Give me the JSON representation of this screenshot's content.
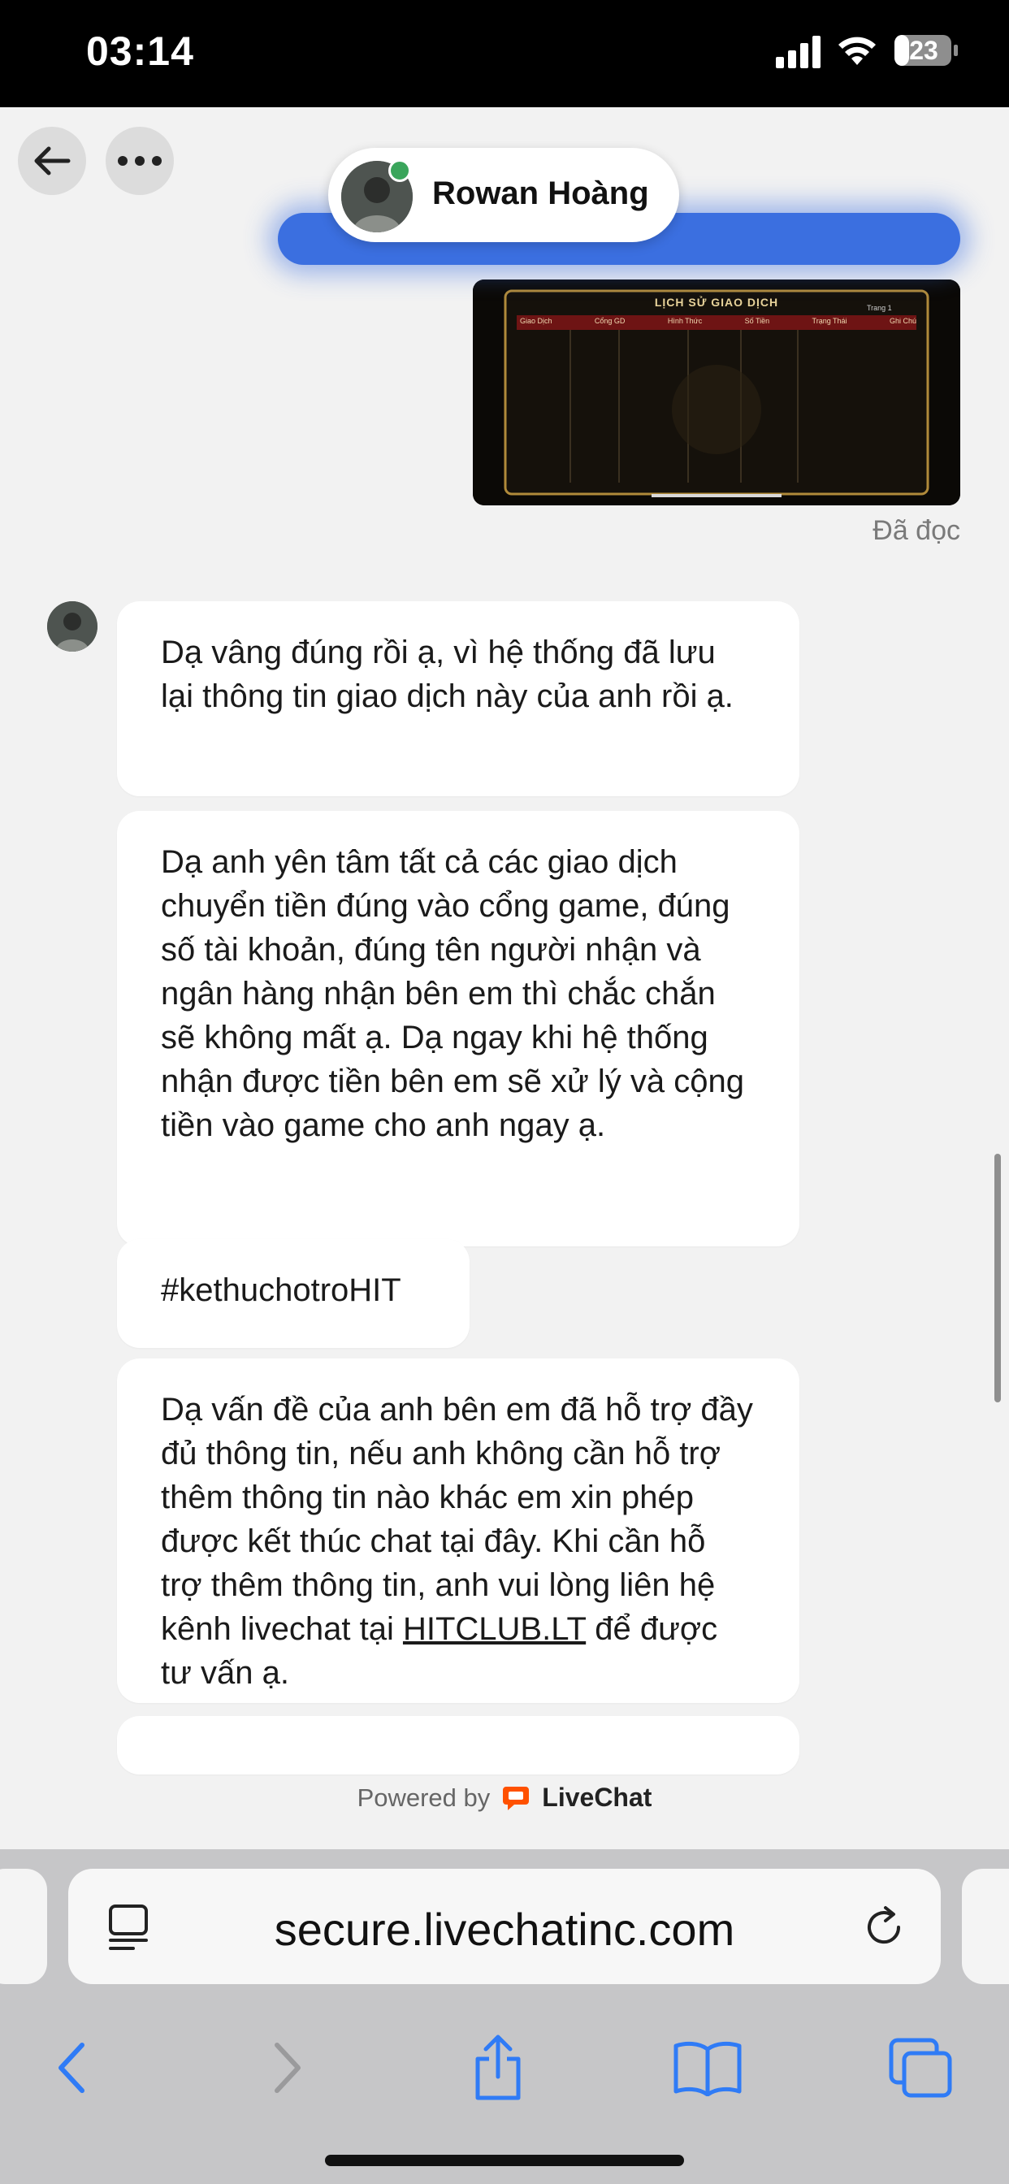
{
  "status_bar": {
    "time": "03:14",
    "battery": "23"
  },
  "header": {
    "contact_name": "Rowan Hoàng"
  },
  "transaction_image": {
    "title": "LỊCH SỬ GIAO DỊCH",
    "columns": [
      "Giao Dịch",
      "Cổng GD",
      "Hình Thức",
      "Số Tiền",
      "Trạng Thái",
      "Ghi Chú"
    ],
    "page_label": "Trang 1"
  },
  "read_receipt": "Đã đọc",
  "messages": [
    "Dạ vâng đúng rồi ạ, vì hệ thống đã lưu lại thông tin giao dịch này của anh rồi ạ.",
    "Dạ anh yên tâm tất cả các giao dịch chuyển tiền đúng vào cổng game, đúng số tài khoản, đúng tên người nhận và ngân hàng nhận bên em thì chắc chắn sẽ không mất ạ. Dạ ngay khi hệ thống nhận được tiền bên em sẽ xử lý và cộng tiền vào game cho anh ngay ạ.",
    "#kethuchotroHIT"
  ],
  "message4": {
    "text_before": "Dạ vấn đề của anh bên em đã hỗ trợ đầy đủ thông tin, nếu anh không cần hỗ trợ thêm thông tin nào khác em xin phép được kết thúc chat tại đây. Khi cần hỗ trợ thêm thông tin, anh vui lòng liên hệ kênh livechat tại ",
    "link": "HITCLUB.LT",
    "text_after": " để được tư vấn ạ."
  },
  "footer": {
    "powered_by": "Powered by",
    "brand": "LiveChat"
  },
  "browser": {
    "url": "secure.livechatinc.com"
  },
  "colors": {
    "online": "#3aa55b",
    "highlight": "#3b6fe0",
    "toolbar_blue": "#2f7bf6",
    "livechat_orange": "#ff5100"
  }
}
